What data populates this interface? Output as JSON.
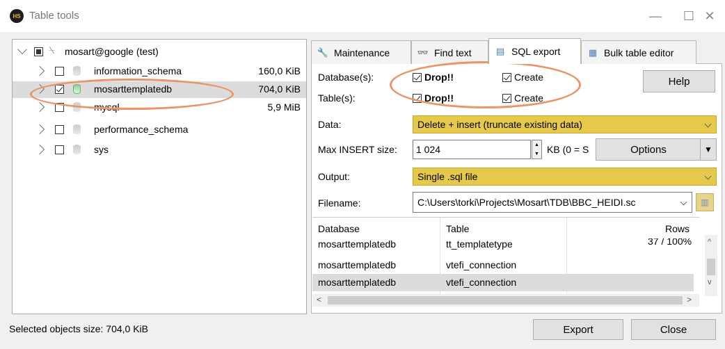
{
  "window": {
    "title": "Table tools",
    "app_icon": "HS",
    "minimize": "—",
    "maximize": "☐",
    "close": "✕"
  },
  "tree": {
    "root": {
      "label": "mosart@google (test)"
    },
    "items": [
      {
        "label": "information_schema",
        "size": "160,0 KiB"
      },
      {
        "label": "mosarttemplatedb",
        "size": "704,0 KiB"
      },
      {
        "label": "mysql",
        "size": "5,9 MiB"
      },
      {
        "label": "performance_schema",
        "size": ""
      },
      {
        "label": "sys",
        "size": ""
      }
    ]
  },
  "tabs": [
    {
      "label": "Maintenance"
    },
    {
      "label": "Find text"
    },
    {
      "label": "SQL export"
    },
    {
      "label": "Bulk table editor"
    }
  ],
  "sql_export": {
    "databases_label": "Database(s):",
    "tables_label": "Table(s):",
    "drop_label": "Drop!!",
    "create_label": "Create",
    "help_button": "Help",
    "data_label": "Data:",
    "data_value": "Delete + insert (truncate existing data)",
    "max_insert_label": "Max INSERT size:",
    "max_insert_value": "1 024",
    "kb_label": "KB (0 = S",
    "options_button": "Options",
    "output_label": "Output:",
    "output_value": "Single .sql file",
    "filename_label": "Filename:",
    "filename_value": "C:\\Users\\torki\\Projects\\Mosart\\TDB\\BBC_HEIDI.sc"
  },
  "results": {
    "columns": [
      "Database",
      "Table",
      "Rows"
    ],
    "rows": [
      {
        "database": "mosarttemplatedb",
        "table": "tt_templatetype",
        "rows": "37 / 100%"
      },
      {
        "database": "mosarttemplatedb",
        "table": "vtefi_connection",
        "rows": ""
      },
      {
        "database": "mosarttemplatedb",
        "table": "vtefi_connection",
        "rows": ""
      }
    ]
  },
  "status": {
    "text": "Selected objects size: 704,0 KiB"
  },
  "buttons": {
    "export": "Export",
    "close": "Close"
  },
  "colors": {
    "accent_combo": "#e6c94a",
    "highlight_ring": "#e8956a"
  }
}
